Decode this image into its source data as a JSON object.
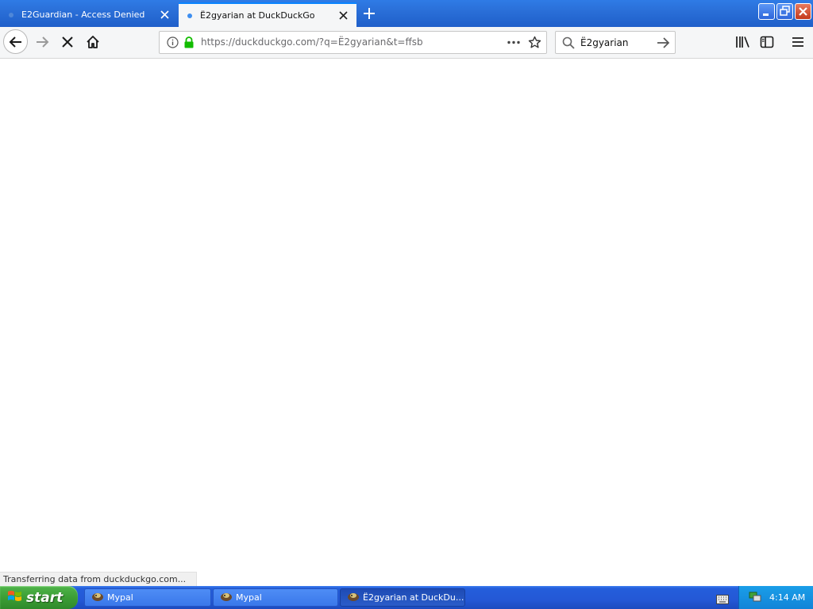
{
  "browser": {
    "tabs": [
      {
        "title": "E2Guardian - Access Denied",
        "active": false
      },
      {
        "title": "Ë2gyarian at DuckDuckGo",
        "active": true
      }
    ],
    "url": "https://duckduckgo.com/?q=Ë2gyarian&t=ffsb",
    "search_query": "Ë2gyarian",
    "status_text": "Transferring data from duckduckgo.com...",
    "icons": [
      "back-icon",
      "forward-icon",
      "stop-icon",
      "home-icon",
      "info-icon",
      "lock-icon",
      "more-icon",
      "bookmark-star-icon",
      "search-icon",
      "arrow-right-icon",
      "library-icon",
      "sidebar-icon",
      "hamburger-menu-icon"
    ]
  },
  "taskbar": {
    "start_label": "start",
    "items": [
      {
        "label": "Mypal",
        "active": false
      },
      {
        "label": "Mypal",
        "active": false
      },
      {
        "label": "Ë2gyarian at DuckDu...",
        "active": true
      }
    ],
    "clock": "4:14 AM"
  },
  "colors": {
    "tab_accent": "#0a84ff",
    "lock_green": "#12bc00",
    "taskbar_blue": "#245edb",
    "start_green": "#3c9e35"
  }
}
